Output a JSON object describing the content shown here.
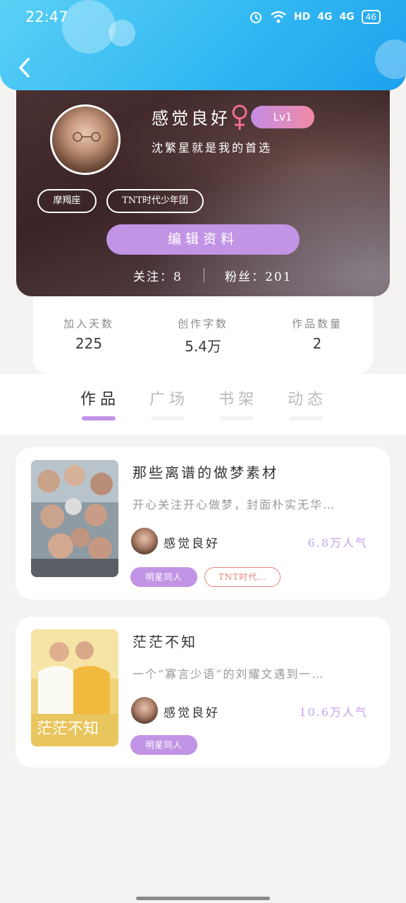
{
  "status_bar": {
    "time": "22:47",
    "battery": "46",
    "icons": [
      "alarm-icon",
      "wifi-icon",
      "hd-icon",
      "signal-4g-icon",
      "signal-4g-icon",
      "battery-icon"
    ],
    "hd": "HD",
    "net1": "4G",
    "net2": "4G"
  },
  "header": {
    "back_icon": "back-chevron-icon",
    "gradient": [
      "#5ad0f6",
      "#1da1ee"
    ]
  },
  "profile": {
    "username": "感觉良好",
    "gender_icon": "female-icon",
    "level": "Lv1",
    "signature": "沈繁星就是我的首选",
    "tags": [
      "摩羯座",
      "TNT时代少年团"
    ],
    "edit_label": "编辑资料",
    "follow_label": "关注：8",
    "fans_label": "粉丝：201"
  },
  "stats": [
    {
      "label": "加入天数",
      "value": "225"
    },
    {
      "label": "创作字数",
      "value": "5.4万"
    },
    {
      "label": "作品数量",
      "value": "2"
    }
  ],
  "tabs": [
    {
      "label": "作品",
      "active": true
    },
    {
      "label": "广场",
      "active": false
    },
    {
      "label": "书架",
      "active": false
    },
    {
      "label": "动态",
      "active": false
    }
  ],
  "works": [
    {
      "title": "那些离谱的做梦素材",
      "desc": "开心关注开心做梦，封面朴实无华…",
      "author": "感觉良好",
      "popularity": "6.8万人气",
      "tags": [
        "明星同人",
        "TNT时代…"
      ]
    },
    {
      "title": "茫茫不知",
      "desc": "一个“寡言少语”的刘耀文遇到一…",
      "author": "感觉良好",
      "popularity": "10.6万人气",
      "tags": [
        "明星同人"
      ],
      "cover_text": "茫茫不知"
    }
  ],
  "colors": {
    "accent": "#c294e5",
    "popularity": "#c8a2ea",
    "tag_outline": "#e4857d"
  }
}
